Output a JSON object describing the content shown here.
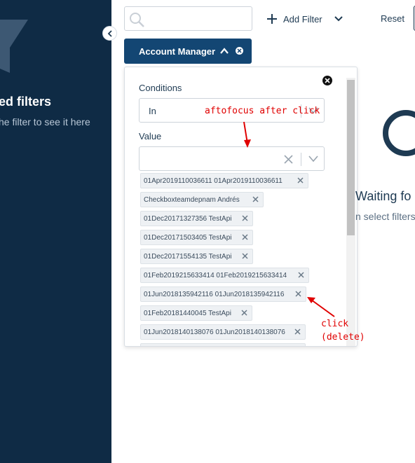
{
  "sidebar": {
    "title": "ed filters",
    "subtitle": "he filter to see it here"
  },
  "search": {
    "value": "",
    "placeholder": ""
  },
  "toolbar": {
    "add_filter_label": "Add Filter",
    "reset_label": "Reset"
  },
  "filter_chip": {
    "label": "Account Manager"
  },
  "panel": {
    "conditions_label": "Conditions",
    "conditions_value": "In",
    "value_label": "Value",
    "value_input": "",
    "tags": [
      "01Apr2019110036611 01Apr2019110036611",
      "Checkboxteamdepnam Andrés",
      "01Dec20171327356 TestApi",
      "01Dec20171503405 TestApi",
      "01Dec20171554135 TestApi",
      "01Feb2019215633414 01Feb2019215633414",
      "01Jun2018135942116 01Jun2018135942116",
      "01Feb20181440045 TestApi",
      "01Jun2018140138076 01Jun2018140138076",
      ""
    ]
  },
  "main": {
    "waiting_title": "Waiting fo",
    "waiting_sub": "n select filters"
  },
  "annotations": {
    "autofocus": "aftofocus after click",
    "click_line1": "click",
    "click_line2": "(delete)"
  },
  "colors": {
    "sidebar_bg": "#0f2b45",
    "chip_bg": "#134673",
    "annotation": "#e00000"
  }
}
